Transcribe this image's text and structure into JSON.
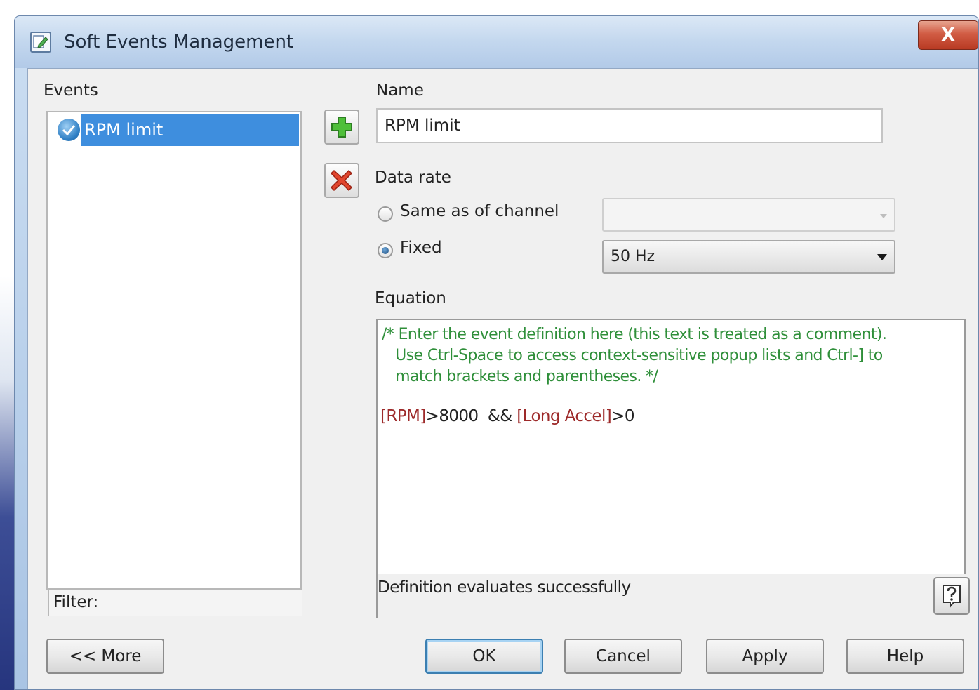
{
  "window": {
    "title": "Soft Events Management",
    "close_label": "X"
  },
  "events": {
    "label": "Events",
    "items": [
      {
        "label": "RPM limit",
        "selected": true
      }
    ],
    "filter_label": "Filter:"
  },
  "icons": {
    "window": "edit-document-icon",
    "add": "green-plus-icon",
    "delete": "red-x-icon",
    "event_status": "blue-check-icon",
    "help": "question-mark-icon"
  },
  "name": {
    "label": "Name",
    "value": "RPM limit"
  },
  "data_rate": {
    "label": "Data rate",
    "options": [
      {
        "label": "Same as of channel",
        "selected": false,
        "combo_value": ""
      },
      {
        "label": "Fixed",
        "selected": true,
        "combo_value": "50 Hz"
      }
    ]
  },
  "equation": {
    "label": "Equation",
    "comment_lines": [
      "/* Enter the event definition here (this text is treated as a comment).",
      "   Use Ctrl-Space to access context-sensitive popup lists and Ctrl-] to",
      "   match brackets and parentheses. */"
    ],
    "expression": {
      "ref1": "[RPM]",
      "op1": ">8000  && ",
      "ref2": "[Long Accel]",
      "op2": ">0"
    },
    "status": "Definition evaluates successfully"
  },
  "buttons": {
    "more": "<< More",
    "ok": "OK",
    "cancel": "Cancel",
    "apply": "Apply",
    "help": "Help"
  },
  "colors": {
    "selection": "#3e8ede",
    "comment": "#2f8f3a",
    "channel_ref": "#9d2a2a",
    "close_button": "#c9452e"
  }
}
